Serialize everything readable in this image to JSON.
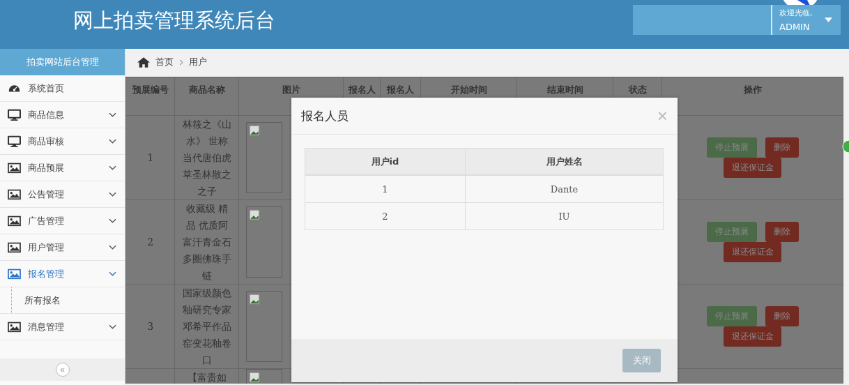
{
  "header": {
    "title": "网上拍卖管理系统后台",
    "welcome": "欢迎光临,",
    "user": "ADMIN"
  },
  "sidebar": {
    "title": "拍卖网站后台管理",
    "collapse": "«",
    "items": [
      {
        "label": "系统首页",
        "kind": "link",
        "selected": false
      },
      {
        "label": "商品信息",
        "kind": "menu",
        "selected": false
      },
      {
        "label": "商品审核",
        "kind": "menu",
        "selected": false
      },
      {
        "label": "商品预展",
        "kind": "menu",
        "selected": false
      },
      {
        "label": "公告管理",
        "kind": "menu",
        "selected": false
      },
      {
        "label": "广告管理",
        "kind": "menu",
        "selected": false
      },
      {
        "label": "用户管理",
        "kind": "menu",
        "selected": false
      },
      {
        "label": "报名管理",
        "kind": "menu",
        "selected": true,
        "expanded": true,
        "children": [
          {
            "label": "所有报名"
          }
        ]
      },
      {
        "label": "消息管理",
        "kind": "menu",
        "selected": false
      }
    ]
  },
  "breadcrumb": [
    "首页",
    "用户"
  ],
  "table": {
    "columns": [
      "预展编号",
      "商品名称",
      "图片",
      "报名人",
      "报名人",
      "开始时间",
      "结束时间",
      "状态",
      "操作"
    ],
    "rows": [
      {
        "id": "1",
        "name": "林筱之《山水》 世称当代唐伯虎草圣林散之之子",
        "actions": [
          {
            "label": "停止预展",
            "kind": "stop"
          },
          {
            "label": "删除",
            "kind": "delete"
          },
          {
            "label": "退还保证金",
            "kind": "refund"
          }
        ]
      },
      {
        "id": "2",
        "name": "收藏级 精品 优质阿富汗青金石多圈佛珠手链",
        "actions": [
          {
            "label": "停止预展",
            "kind": "stop"
          },
          {
            "label": "删除",
            "kind": "delete"
          },
          {
            "label": "退还保证金",
            "kind": "refund"
          }
        ]
      },
      {
        "id": "3",
        "name": "国家级颜色釉研究专家邓希平作品窑变花釉卷口",
        "actions": [
          {
            "label": "停止预展",
            "kind": "stop"
          },
          {
            "label": "删除",
            "kind": "delete"
          },
          {
            "label": "退还保证金",
            "kind": "refund"
          }
        ]
      },
      {
        "name": "【富贵如",
        "actions": []
      }
    ]
  },
  "modal": {
    "title": "报名人员",
    "close": "×",
    "columns": [
      "用户id",
      "用户姓名"
    ],
    "rows": [
      [
        "1",
        "Dante"
      ],
      [
        "2",
        "IU"
      ]
    ],
    "button": "关闭"
  }
}
